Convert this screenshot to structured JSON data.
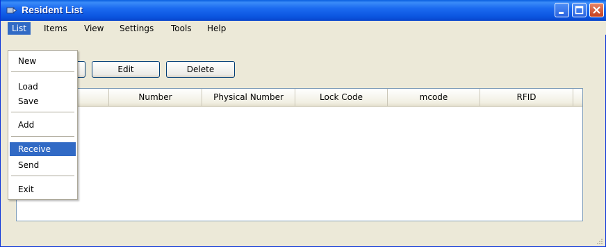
{
  "window": {
    "title": "Resident List"
  },
  "menubar": {
    "items": [
      "List",
      "Items",
      "View",
      "Settings",
      "Tools",
      "Help"
    ]
  },
  "toolbar": {
    "edit_label": "Edit",
    "delete_label": "Delete"
  },
  "table": {
    "columns": [
      "",
      "Number",
      "Physical Number",
      "Lock Code",
      "mcode",
      "RFID"
    ]
  },
  "list_menu": {
    "items": [
      "New",
      "Load",
      "Save",
      "Add",
      "Receive",
      "Send",
      "Exit"
    ],
    "highlighted": "Receive"
  },
  "colors": {
    "title_bar": "#0a5fe0",
    "highlight": "#316ac5",
    "window_face": "#ece9d8"
  }
}
